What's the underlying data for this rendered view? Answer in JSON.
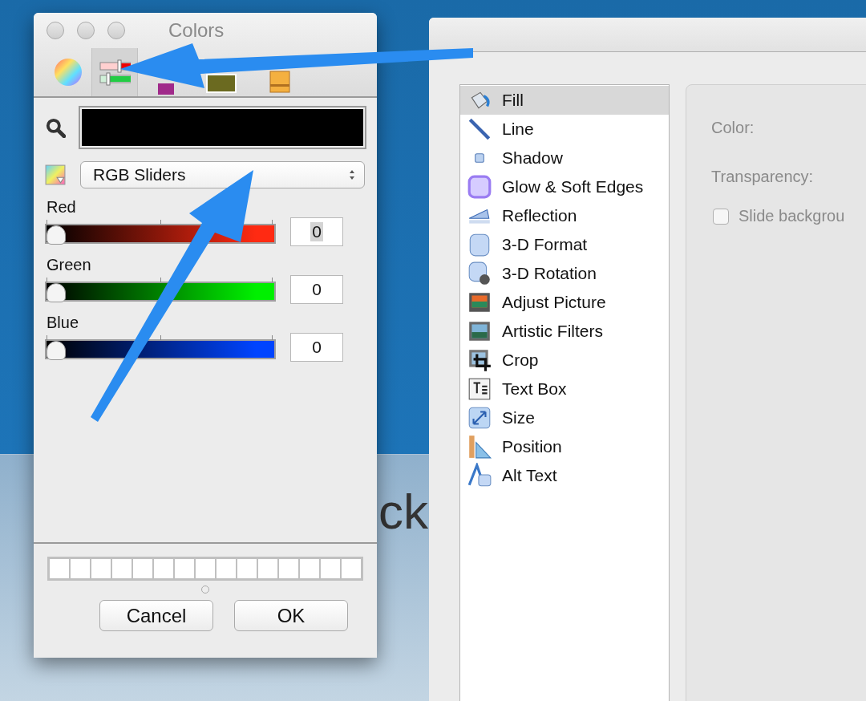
{
  "background": {
    "slide_text": "ck"
  },
  "colors_window": {
    "title": "Colors",
    "tabs": [
      {
        "kind": "wheel",
        "selected": false
      },
      {
        "kind": "sliders",
        "selected": true
      },
      {
        "kind": "palettes",
        "selected": false
      },
      {
        "kind": "image",
        "selected": false
      },
      {
        "kind": "pencils",
        "selected": false
      }
    ],
    "picker": {
      "mode": "RGB Sliders"
    },
    "sliders": [
      {
        "name": "Red",
        "color": "#ff2a12",
        "level": 0,
        "value": "0",
        "value_highlighted": true
      },
      {
        "name": "Green",
        "color": "#00f000",
        "level": 0,
        "value": "0",
        "value_highlighted": false
      },
      {
        "name": "Blue",
        "color": "#0044ff",
        "level": 0,
        "value": "0",
        "value_highlighted": false
      }
    ],
    "buttons": [
      "Cancel",
      "OK"
    ]
  },
  "format_window": {
    "items": [
      {
        "label": "Fill",
        "kind": "fill",
        "selected": true
      },
      {
        "label": "Line",
        "kind": "line",
        "selected": false
      },
      {
        "label": "Shadow",
        "kind": "shadow",
        "selected": false
      },
      {
        "label": "Glow & Soft Edges",
        "kind": "glow",
        "selected": false
      },
      {
        "label": "Reflection",
        "kind": "reflection",
        "selected": false
      },
      {
        "label": "3-D Format",
        "kind": "format3d",
        "selected": false
      },
      {
        "label": "3-D Rotation",
        "kind": "rotation3d",
        "selected": false
      },
      {
        "label": "Adjust Picture",
        "kind": "adjust",
        "selected": false
      },
      {
        "label": "Artistic Filters",
        "kind": "filters",
        "selected": false
      },
      {
        "label": "Crop",
        "kind": "crop",
        "selected": false
      },
      {
        "label": "Text Box",
        "kind": "textbox",
        "selected": false
      },
      {
        "label": "Size",
        "kind": "size",
        "selected": false
      },
      {
        "label": "Position",
        "kind": "position",
        "selected": false
      },
      {
        "label": "Alt Text",
        "kind": "alttext",
        "selected": false
      }
    ],
    "color_label": "Color:",
    "transparency_label": "Transparency:",
    "checkbox": {
      "label": "Slide backgrou",
      "checked": false
    }
  }
}
